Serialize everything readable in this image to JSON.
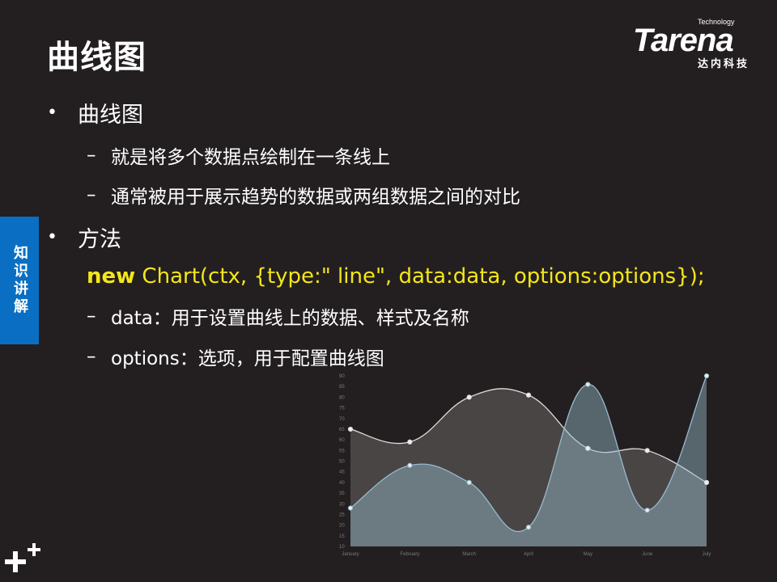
{
  "slide": {
    "title": "曲线图",
    "logo": {
      "word": "Tarena",
      "sub": "Technology",
      "cn": "达内科技"
    },
    "side_tab": "知识讲解",
    "bullets": [
      {
        "text": "曲线图",
        "subs": [
          "就是将多个数据点绘制在一条线上",
          "通常被用于展示趋势的数据或两组数据之间的对比"
        ]
      },
      {
        "text": "方法",
        "code_keyword": "new",
        "code_rest": " Chart(ctx, {type:\" line\", data:data, options:options});",
        "subs": [
          "data：用于设置曲线上的数据、样式及名称",
          "options：选项，用于配置曲线图"
        ]
      }
    ],
    "colors": {
      "background": "#231f20",
      "code": "#f5e61a",
      "side_tab": "#0a6fc2"
    }
  },
  "chart_data": {
    "type": "line",
    "categories": [
      "January",
      "February",
      "March",
      "April",
      "May",
      "June",
      "July"
    ],
    "series": [
      {
        "values": [
          65,
          59,
          80,
          81,
          56,
          55,
          40
        ],
        "fill": "#4a4545",
        "stroke": "#dcdcdc"
      },
      {
        "values": [
          28,
          48,
          40,
          19,
          86,
          27,
          90
        ],
        "fill": "rgba(151,187,205,0.45)",
        "stroke": "#97bbcd"
      }
    ],
    "yticks": [
      10,
      15,
      20,
      25,
      30,
      35,
      40,
      45,
      50,
      55,
      60,
      65,
      70,
      75,
      80,
      85,
      90
    ],
    "ylim": [
      10,
      90
    ],
    "grid": false
  }
}
